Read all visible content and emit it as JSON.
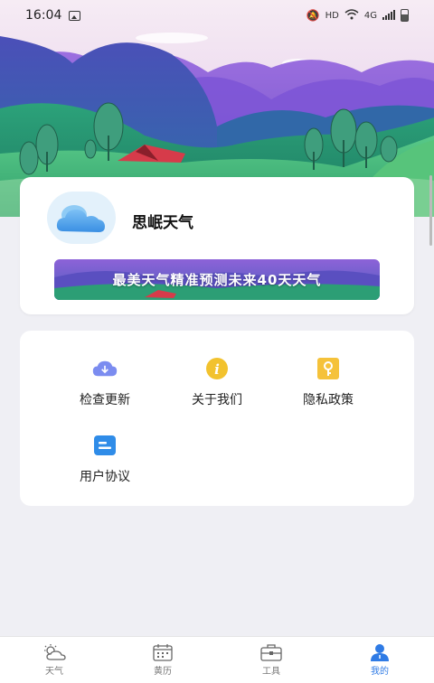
{
  "status_bar": {
    "time": "16:04",
    "hd": "HD",
    "network": "4G"
  },
  "profile": {
    "app_name": "思岷天气",
    "banner_text": "最美天气精准预测未来40天天气"
  },
  "menu": {
    "check_update": "检查更新",
    "about_us": "关于我们",
    "privacy_policy": "隐私政策",
    "user_agreement": "用户协议"
  },
  "bottom_nav": {
    "weather": "天气",
    "calendar": "黄历",
    "tools": "工具",
    "mine": "我的",
    "active": "mine"
  },
  "colors": {
    "accent": "#2f7be5",
    "update_icon": "#7b8cf0",
    "about_icon": "#f2c22e",
    "privacy_icon": "#f5c23a",
    "agreement_icon": "#2f8ce8"
  }
}
